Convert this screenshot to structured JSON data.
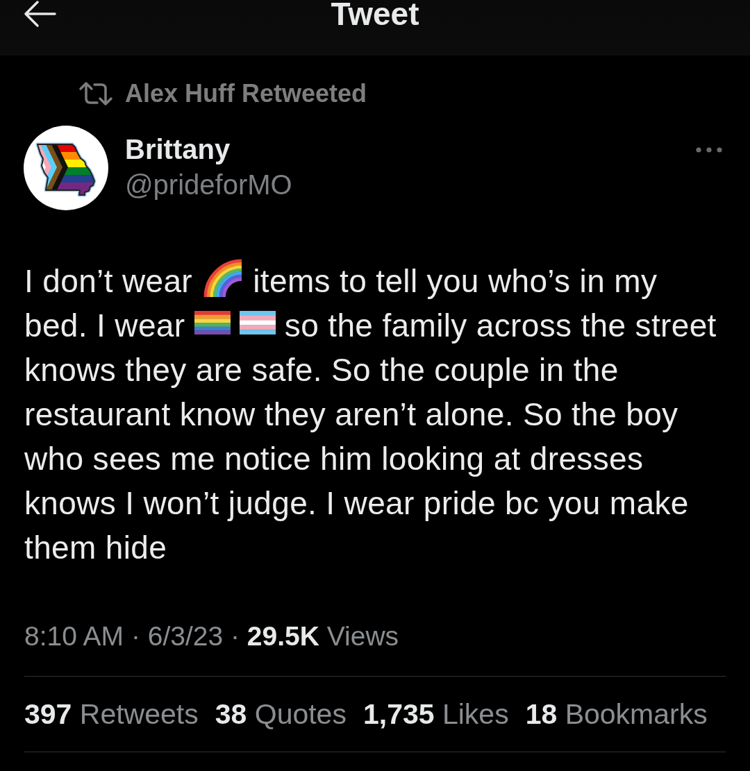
{
  "header": {
    "title": "Tweet"
  },
  "retweeted_by": {
    "text": "Alex Huff Retweeted"
  },
  "author": {
    "name": "Brittany",
    "handle": "@prideforMO"
  },
  "body": [
    {
      "kind": "text",
      "text": "I don’t wear"
    },
    {
      "kind": "rainbow"
    },
    {
      "kind": "text",
      "text": "items to tell you who’s in my bed. I wear"
    },
    {
      "kind": "rainbow_flag"
    },
    {
      "kind": "trans_flag"
    },
    {
      "kind": "text",
      "text": "so the family across the street knows they are safe. So the couple in the restaurant know they aren’t alone. So the boy who sees me notice him looking at dresses knows I won’t judge. I wear pride bc you make them hide"
    }
  ],
  "meta": "8:10 AM · 6/3/23 · **29.5K** Views",
  "stats": [
    "**397** Retweets",
    "**38** Quotes",
    "**1,735** Likes",
    "**18** Bookmarks"
  ]
}
